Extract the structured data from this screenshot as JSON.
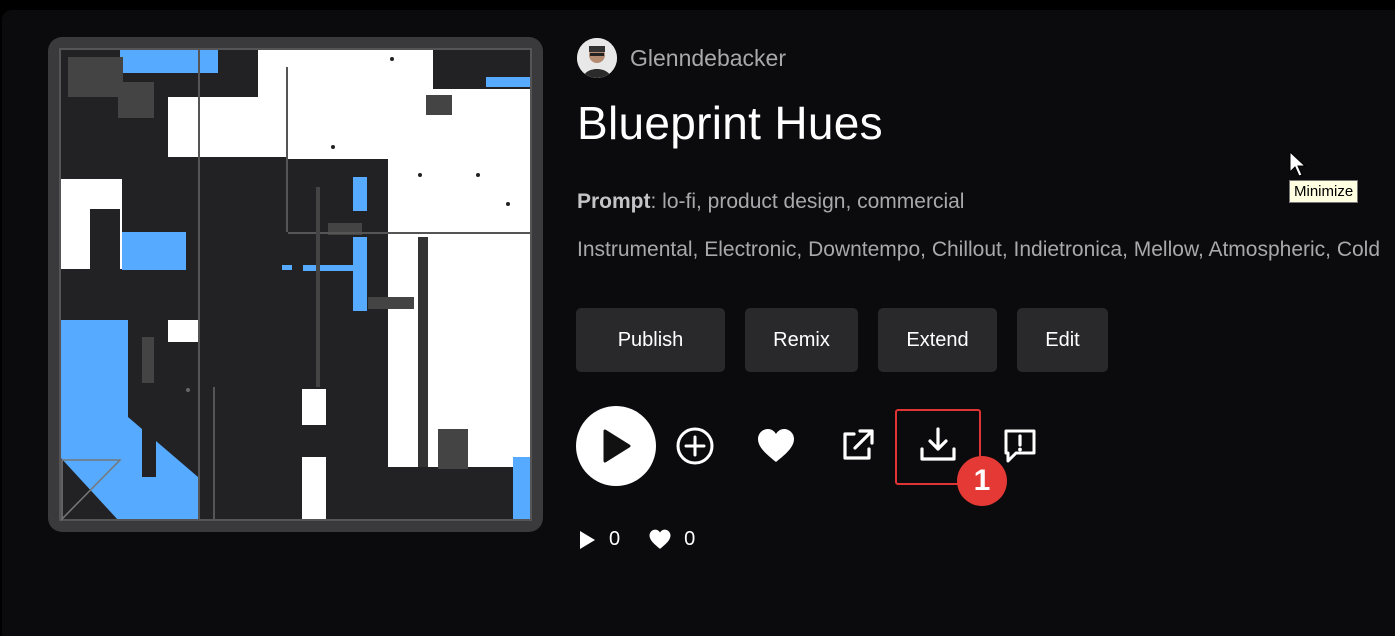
{
  "author": {
    "name": "Glenndebacker"
  },
  "song": {
    "title": "Blueprint Hues"
  },
  "prompt": {
    "label": "Prompt",
    "text": "lo-fi, product design, commercial"
  },
  "tags": "Instrumental, Electronic, Downtempo, Chillout, Indietronica, Mellow, Atmospheric, Cold",
  "actions": {
    "publish": "Publish",
    "remix": "Remix",
    "extend": "Extend",
    "edit": "Edit"
  },
  "icons": {
    "play": "play-icon",
    "add": "plus-circle-icon",
    "like": "heart-icon",
    "share": "external-link-icon",
    "download": "download-icon",
    "report": "report-icon"
  },
  "annotation": {
    "badge": "1"
  },
  "stats": {
    "plays": "0",
    "likes": "0"
  },
  "tooltip": "Minimize",
  "colors": {
    "accent_blue": "#56aaff",
    "highlight_red": "#e03434"
  }
}
